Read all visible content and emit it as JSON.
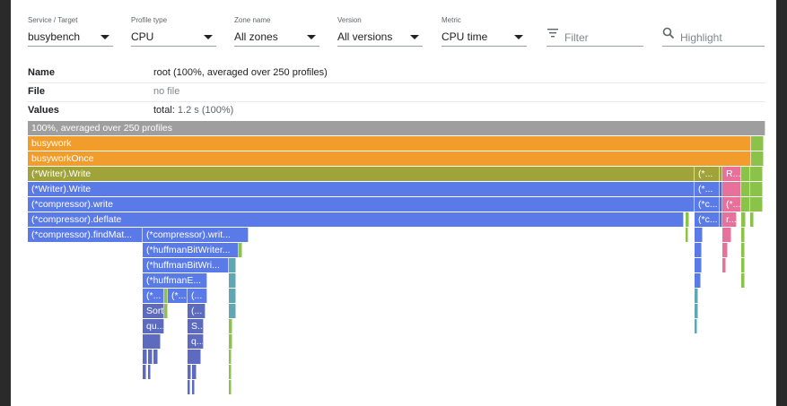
{
  "filters": [
    {
      "label": "Service / Target",
      "value": "busybench"
    },
    {
      "label": "Profile type",
      "value": "CPU"
    },
    {
      "label": "Zone name",
      "value": "All zones"
    },
    {
      "label": "Version",
      "value": "All versions"
    },
    {
      "label": "Metric",
      "value": "CPU time"
    }
  ],
  "filter_search": {
    "placeholder": "Filter"
  },
  "highlight_search": {
    "placeholder": "Highlight"
  },
  "info": {
    "name_label": "Name",
    "name_value": "root (100%, averaged over 250 profiles)",
    "file_label": "File",
    "file_value": "no file",
    "values_label": "Values",
    "values_value_prefix": "total:",
    "values_value": "1.2 s (100%)"
  },
  "flame": {
    "root": "100%, averaged over 250 profiles",
    "busywork": "busywork",
    "busyworkOnce": "busyworkOnce",
    "writer_write_1": "(*Writer).Write",
    "writer_write_1_side": "(*...",
    "writer_write_1_side2": "R...",
    "writer_write_2": "(*Writer).Write",
    "writer_write_2_side": "(*...",
    "compressor_write": "(*compressor).write",
    "compressor_write_side": "(*c...",
    "compressor_write_side2": "(*...",
    "compressor_deflate": "(*compressor).deflate",
    "compressor_deflate_side": "(*c...",
    "compressor_deflate_side2": "r...",
    "find_match": "(*compressor).findMat...",
    "compressor_writ": "(*compressor).writ...",
    "huffman_writer": "(*huffmanBitWriter...",
    "huffman_wri": "(*huffmanBitWri...",
    "huffman_e": "(*huffmanE...",
    "c1": "(*...",
    "c2": "(*...",
    "c3": "(...",
    "sort": "Sort",
    "c4": "(...",
    "qu": "qu...",
    "s": "S...",
    "q": "q..."
  },
  "colors": {
    "root": "#9e9e9e",
    "orange": "#f29c2b",
    "olive": "#9fa33a",
    "blue": "#5a7ae8",
    "pink": "#e8719b",
    "green": "#8bc34a",
    "slate": "#5c6bc0",
    "teal": "#5fa7b3"
  }
}
